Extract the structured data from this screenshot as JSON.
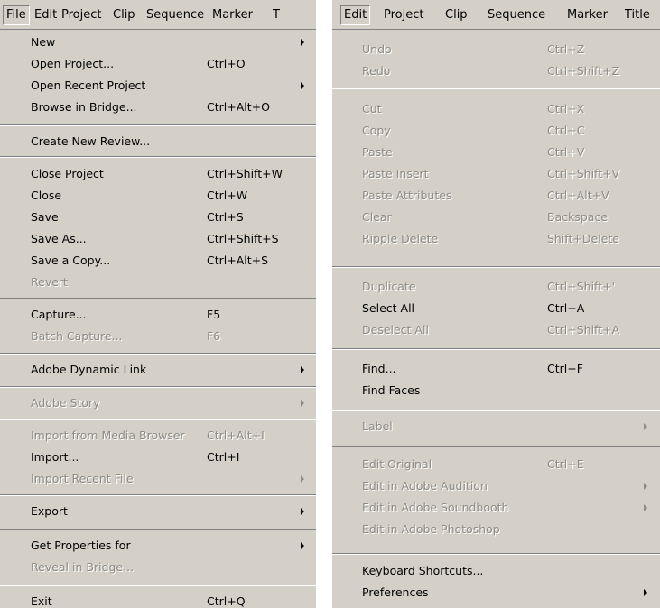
{
  "file_panel": {
    "menubar": [
      "File",
      "Edit",
      "Project",
      "Clip",
      "Sequence",
      "Marker",
      "T"
    ],
    "items": [
      {
        "label": "New",
        "shortcut": "",
        "submenu": true,
        "disabled": false
      },
      {
        "label": "Open Project...",
        "shortcut": "Ctrl+O",
        "submenu": false,
        "disabled": false
      },
      {
        "label": "Open Recent Project",
        "shortcut": "",
        "submenu": true,
        "disabled": false
      },
      {
        "label": "Browse in Bridge...",
        "shortcut": "Ctrl+Alt+O",
        "submenu": false,
        "disabled": false
      },
      {
        "label": "Create New Review...",
        "shortcut": "",
        "submenu": false,
        "disabled": false
      },
      {
        "label": "Close Project",
        "shortcut": "Ctrl+Shift+W",
        "submenu": false,
        "disabled": false
      },
      {
        "label": "Close",
        "shortcut": "Ctrl+W",
        "submenu": false,
        "disabled": false
      },
      {
        "label": "Save",
        "shortcut": "Ctrl+S",
        "submenu": false,
        "disabled": false
      },
      {
        "label": "Save As...",
        "shortcut": "Ctrl+Shift+S",
        "submenu": false,
        "disabled": false
      },
      {
        "label": "Save a Copy...",
        "shortcut": "Ctrl+Alt+S",
        "submenu": false,
        "disabled": false
      },
      {
        "label": "Revert",
        "shortcut": "",
        "submenu": false,
        "disabled": true
      },
      {
        "label": "Capture...",
        "shortcut": "F5",
        "submenu": false,
        "disabled": false
      },
      {
        "label": "Batch Capture...",
        "shortcut": "F6",
        "submenu": false,
        "disabled": true
      },
      {
        "label": "Adobe Dynamic Link",
        "shortcut": "",
        "submenu": true,
        "disabled": false
      },
      {
        "label": "Adobe Story",
        "shortcut": "",
        "submenu": true,
        "disabled": true
      },
      {
        "label": "Import from Media Browser",
        "shortcut": "Ctrl+Alt+I",
        "submenu": false,
        "disabled": true
      },
      {
        "label": "Import...",
        "shortcut": "Ctrl+I",
        "submenu": false,
        "disabled": false
      },
      {
        "label": "Import Recent File",
        "shortcut": "",
        "submenu": true,
        "disabled": true
      },
      {
        "label": "Export",
        "shortcut": "",
        "submenu": true,
        "disabled": false
      },
      {
        "label": "Get Properties for",
        "shortcut": "",
        "submenu": true,
        "disabled": false
      },
      {
        "label": "Reveal in Bridge...",
        "shortcut": "",
        "submenu": false,
        "disabled": true
      },
      {
        "label": "Exit",
        "shortcut": "Ctrl+Q",
        "submenu": false,
        "disabled": false
      }
    ]
  },
  "edit_panel": {
    "menubar": [
      "Edit",
      "Project",
      "Clip",
      "Sequence",
      "Marker",
      "Title"
    ],
    "items": [
      {
        "label": "Undo",
        "shortcut": "Ctrl+Z",
        "submenu": false,
        "disabled": true
      },
      {
        "label": "Redo",
        "shortcut": "Ctrl+Shift+Z",
        "submenu": false,
        "disabled": true
      },
      {
        "label": "Cut",
        "shortcut": "Ctrl+X",
        "submenu": false,
        "disabled": true
      },
      {
        "label": "Copy",
        "shortcut": "Ctrl+C",
        "submenu": false,
        "disabled": true
      },
      {
        "label": "Paste",
        "shortcut": "Ctrl+V",
        "submenu": false,
        "disabled": true
      },
      {
        "label": "Paste Insert",
        "shortcut": "Ctrl+Shift+V",
        "submenu": false,
        "disabled": true
      },
      {
        "label": "Paste Attributes",
        "shortcut": "Ctrl+Alt+V",
        "submenu": false,
        "disabled": true
      },
      {
        "label": "Clear",
        "shortcut": "Backspace",
        "submenu": false,
        "disabled": true
      },
      {
        "label": "Ripple Delete",
        "shortcut": "Shift+Delete",
        "submenu": false,
        "disabled": true
      },
      {
        "label": "Duplicate",
        "shortcut": "Ctrl+Shift+'",
        "submenu": false,
        "disabled": true
      },
      {
        "label": "Select All",
        "shortcut": "Ctrl+A",
        "submenu": false,
        "disabled": false
      },
      {
        "label": "Deselect All",
        "shortcut": "Ctrl+Shift+A",
        "submenu": false,
        "disabled": true
      },
      {
        "label": "Find...",
        "shortcut": "Ctrl+F",
        "submenu": false,
        "disabled": false
      },
      {
        "label": "Find Faces",
        "shortcut": "",
        "submenu": false,
        "disabled": false
      },
      {
        "label": "Label",
        "shortcut": "",
        "submenu": true,
        "disabled": true
      },
      {
        "label": "Edit Original",
        "shortcut": "Ctrl+E",
        "submenu": false,
        "disabled": true
      },
      {
        "label": "Edit in Adobe Audition",
        "shortcut": "",
        "submenu": true,
        "disabled": true
      },
      {
        "label": "Edit in Adobe Soundbooth",
        "shortcut": "",
        "submenu": true,
        "disabled": true
      },
      {
        "label": "Edit in Adobe Photoshop",
        "shortcut": "",
        "submenu": false,
        "disabled": true
      },
      {
        "label": "Keyboard Shortcuts...",
        "shortcut": "",
        "submenu": false,
        "disabled": false
      },
      {
        "label": "Preferences",
        "shortcut": "",
        "submenu": true,
        "disabled": false
      }
    ]
  }
}
